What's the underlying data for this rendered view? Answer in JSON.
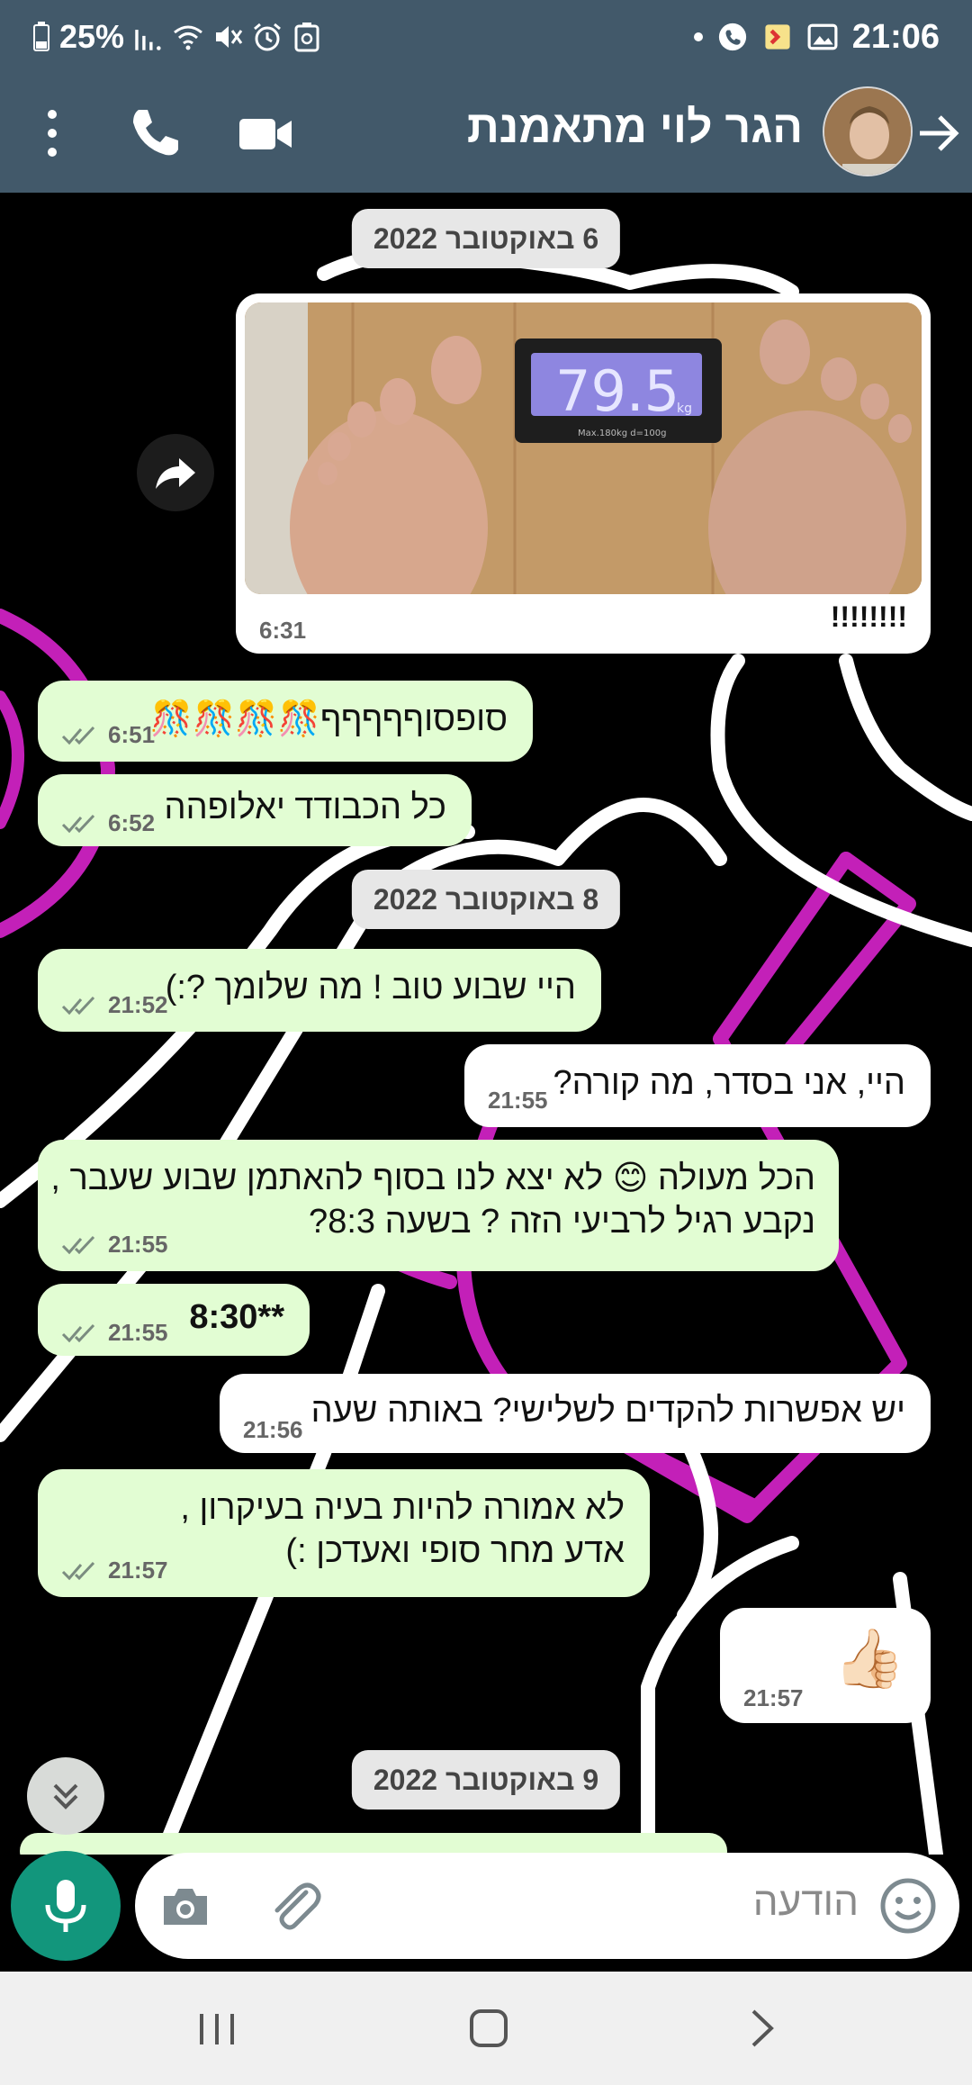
{
  "status_bar": {
    "battery_percent": "25%",
    "time": "21:06"
  },
  "header": {
    "contact_name": "הגר לוי מתאמנת"
  },
  "chat": {
    "dates": {
      "oct6": "6 באוקטובר 2022",
      "oct8": "8 באוקטובר 2022",
      "oct9": "9 באוקטובר 2022"
    },
    "image_message": {
      "scale_reading": "79.5",
      "scale_unit": "kg",
      "scale_caption": "Max.180kg  d=100g",
      "caption": "!!!!!!!!",
      "time": "6:31"
    },
    "messages": [
      {
        "text": "סופסוףףףףף🎊🎊🎊🎊",
        "time": "6:51"
      },
      {
        "text": "כל הכבודד יאלופהה",
        "time": "6:52"
      },
      {
        "text": "היי שבוע טוב ! מה שלומך ?:)",
        "time": "21:52"
      },
      {
        "text": "היי, אני בסדר, מה קורה?",
        "time": "21:55"
      },
      {
        "line1": "הכל מעולה 😊 לא יצא לנו בסוף להאתמן שבוע שעבר ,",
        "line2": "נקבע רגיל לרביעי הזה ? בשעה 8:3?",
        "time": "21:55"
      },
      {
        "text": "**8:30",
        "time": "21:55"
      },
      {
        "text": "יש אפשרות להקדים לשלישי? באותה שעה",
        "time": "21:56"
      },
      {
        "line1": "לא אמורה להיות בעיה בעיקרון ,",
        "line2": "אדע מחר סופי ואעדכן :)",
        "time": "21:57"
      },
      {
        "text": "👍🏻",
        "time": "21:57"
      }
    ]
  },
  "input": {
    "placeholder": "הודעה"
  },
  "colors": {
    "header_bg": "#42596a",
    "outgoing_bubble": "#e2fdd3",
    "incoming_bubble": "#ffffff",
    "mic_button": "#12967c",
    "wallpaper_magenta": "#c320b8"
  }
}
